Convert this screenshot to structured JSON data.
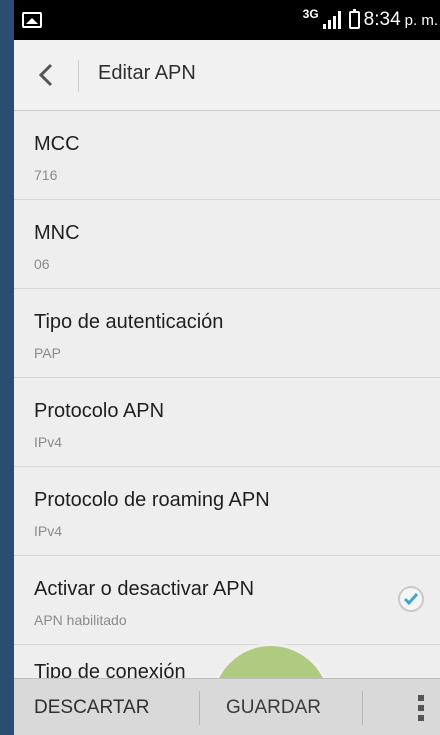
{
  "status_bar": {
    "network_type": "3G",
    "time": "8:34",
    "ampm": "p. m."
  },
  "header": {
    "title": "Editar APN"
  },
  "settings": [
    {
      "label": "MCC",
      "value": "716"
    },
    {
      "label": "MNC",
      "value": "06"
    },
    {
      "label": "Tipo de autenticación",
      "value": "PAP"
    },
    {
      "label": "Protocolo APN",
      "value": "IPv4"
    },
    {
      "label": "Protocolo de roaming APN",
      "value": "IPv4"
    },
    {
      "label": "Activar o desactivar APN",
      "value": "APN habilitado",
      "checked": true
    }
  ],
  "partial_item": {
    "label": "Tipo de conexión"
  },
  "bottom_bar": {
    "discard_label": "DESCARTAR",
    "save_label": "GUARDAR"
  },
  "colors": {
    "accent": "#3fa3d4",
    "highlight": "#a4c46c",
    "status_bar": "#000000"
  },
  "icons": {
    "back": "chevron-left-icon",
    "overflow": "overflow-menu-icon",
    "check": "checkbox-checked-icon"
  }
}
